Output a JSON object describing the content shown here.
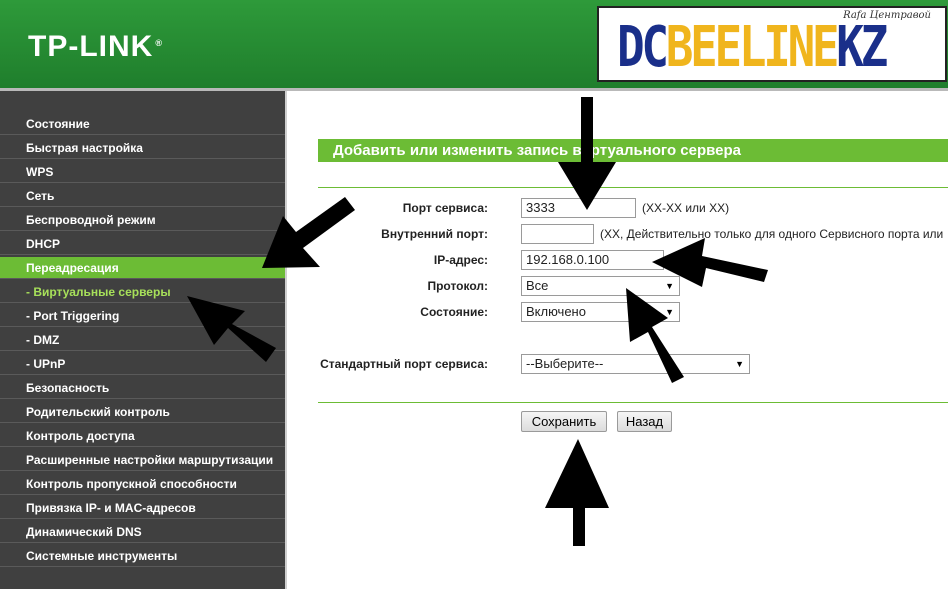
{
  "header": {
    "brand": "TP-LINK",
    "brand_mark": "®"
  },
  "watermark": {
    "dc": "DC",
    "beeline": "BEELINE",
    "kz": "KZ",
    "author": "Rafa Центравой"
  },
  "sidebar": {
    "items": [
      {
        "label": "Состояние"
      },
      {
        "label": "Быстрая настройка"
      },
      {
        "label": "WPS"
      },
      {
        "label": "Сеть"
      },
      {
        "label": "Беспроводной режим"
      },
      {
        "label": "DHCP"
      },
      {
        "label": "Переадресация"
      },
      {
        "label": "- Виртуальные серверы"
      },
      {
        "label": "- Port Triggering"
      },
      {
        "label": "- DMZ"
      },
      {
        "label": "- UPnP"
      },
      {
        "label": "Безопасность"
      },
      {
        "label": "Родительский контроль"
      },
      {
        "label": "Контроль доступа"
      },
      {
        "label": "Расширенные настройки маршрутизации"
      },
      {
        "label": "Контроль пропускной способности"
      },
      {
        "label": "Привязка IP- и MAC-адресов"
      },
      {
        "label": "Динамический DNS"
      },
      {
        "label": "Системные инструменты"
      }
    ]
  },
  "form": {
    "title": "Добавить или изменить запись виртуального сервера",
    "service_port": {
      "label": "Порт сервиса:",
      "value": "3333",
      "hint": "(XX-XX или XX)"
    },
    "internal_port": {
      "label": "Внутренний порт:",
      "value": "",
      "hint": "(XX, Действительно только для одного Сервисного порта или"
    },
    "ip_address": {
      "label": "IP-адрес:",
      "value": "192.168.0.100"
    },
    "protocol": {
      "label": "Протокол:",
      "value": "Все"
    },
    "status": {
      "label": "Состояние:",
      "value": "Включено"
    },
    "standard_port": {
      "label": "Стандартный порт сервиса:",
      "value": "--Выберите--"
    },
    "save_label": "Сохранить",
    "back_label": "Назад"
  },
  "colors": {
    "accent": "#6cbc35",
    "header": "#2e9a3a",
    "sidebar": "#404040"
  }
}
